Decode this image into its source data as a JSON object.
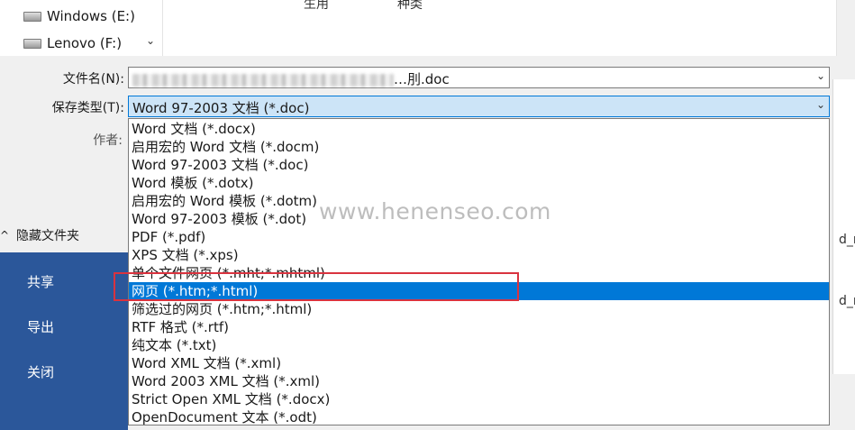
{
  "nav_pane": {
    "drives": [
      {
        "label": "Windows (E:)",
        "icon": "drive-icon"
      },
      {
        "label": "Lenovo (F:)",
        "icon": "drive-icon"
      }
    ],
    "scroll_down_icon": "⌄"
  },
  "file_list": {
    "partial_column_texts": [
      "生用",
      "种类"
    ]
  },
  "form": {
    "filename_label": "文件名(N):",
    "filename_value": "…刖.doc",
    "filetype_label": "保存类型(T):",
    "filetype_value": "Word 97-2003 文档 (*.doc)",
    "author_label": "作者:",
    "chevron": "⌄"
  },
  "hide_folders": {
    "label": "隐藏文件夹",
    "caret": "^"
  },
  "backstage": {
    "items": [
      "共享",
      "导出",
      "关闭"
    ],
    "color": "#2b579a"
  },
  "dropdown": {
    "options": [
      "Word 文档 (*.docx)",
      "启用宏的 Word 文档 (*.docm)",
      "Word 97-2003 文档 (*.doc)",
      "Word 模板 (*.dotx)",
      "启用宏的 Word 模板 (*.dotm)",
      "Word 97-2003 模板 (*.dot)",
      "PDF (*.pdf)",
      "XPS 文档 (*.xps)",
      "单个文件网页 (*.mht;*.mhtml)",
      "网页 (*.htm;*.html)",
      "筛选过的网页 (*.htm;*.html)",
      "RTF 格式 (*.rtf)",
      "纯文本 (*.txt)",
      "Word XML 文档 (*.xml)",
      "Word 2003 XML 文档 (*.xml)",
      "Strict Open XML 文档 (*.docx)",
      "OpenDocument 文本 (*.odt)"
    ],
    "selected_option": "网页 (*.htm;*.html)",
    "selected_color": "#0078d7",
    "annotation_color": "#d9333f"
  },
  "right_panel": {
    "peek_texts": [
      "d_n",
      "d_n"
    ]
  },
  "watermark": "www.henenseo.com"
}
